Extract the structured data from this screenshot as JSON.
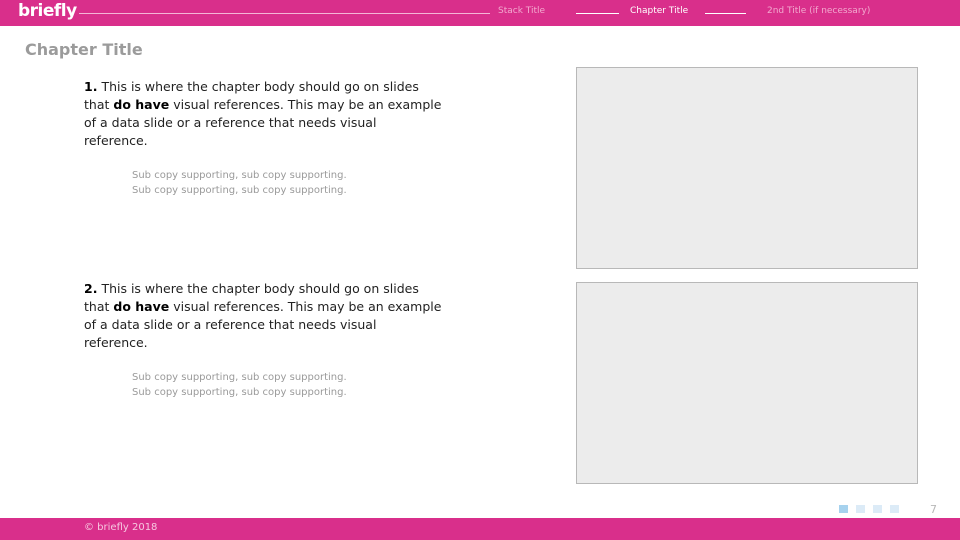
{
  "header": {
    "logo_text": "briefly",
    "nav": [
      {
        "label": "Stack Title",
        "active": false
      },
      {
        "label": "Chapter Title",
        "active": true
      },
      {
        "label": "2nd Title (if necessary)",
        "active": false
      }
    ]
  },
  "main": {
    "chapter_title": "Chapter Title",
    "items": [
      {
        "number": "1.",
        "text_before": "This is where the chapter body should go on slides that",
        "bold": "do have",
        "text_after": "visual references. This may be an example of a data slide or a reference that needs visual reference.",
        "sub_lines": [
          "Sub copy supporting, sub copy supporting.",
          "Sub copy supporting, sub copy supporting."
        ]
      },
      {
        "number": "2.",
        "text_before": "This is where the chapter body should go on slides that",
        "bold": "do have",
        "text_after": "visual references. This may be an example of a data slide or a reference that needs visual reference.",
        "sub_lines": [
          "Sub copy supporting, sub copy supporting.",
          "Sub copy supporting, sub copy supporting."
        ]
      }
    ]
  },
  "footer": {
    "copyright": "© briefly 2018",
    "page_number": "7",
    "progress": {
      "total": 4,
      "current": 1
    }
  },
  "colors": {
    "brand": "#d92f8b",
    "placeholder_fill": "#ececec",
    "dot_active": "#a6d2ee",
    "dot_inactive": "#dcebf7"
  }
}
